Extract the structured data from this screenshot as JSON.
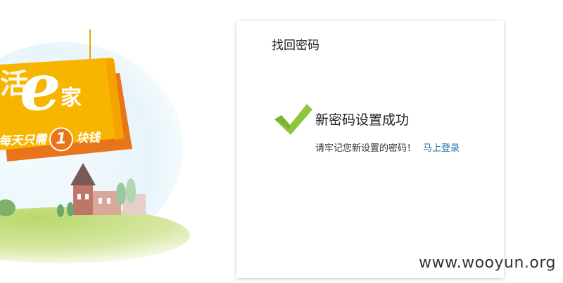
{
  "promo": {
    "brand_letter": "e",
    "brand_clipped": "活",
    "brand_home": "家",
    "slogan_before": "每天只需",
    "slogan_number": "1",
    "slogan_after": "块钱"
  },
  "card": {
    "title": "找回密码",
    "success_title": "新密码设置成功",
    "success_note": "请牢记您新设置的密码！",
    "login_link": "马上登录"
  },
  "watermark": "www.wooyun.org",
  "colors": {
    "banner_yellow": "#f7b500",
    "banner_orange": "#e8751a",
    "check_green": "#8cc63f",
    "link_blue": "#1a6fa0"
  },
  "icons": [
    "checkmark-icon"
  ]
}
